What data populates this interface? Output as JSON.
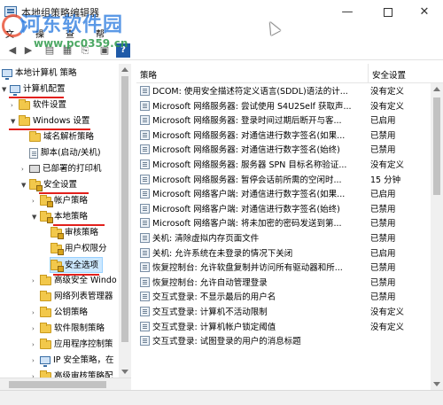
{
  "window": {
    "title": "本地组策略编辑器",
    "minimize": "—",
    "close": "✕"
  },
  "watermark": {
    "text": "河东软件园",
    "url": "www.pc0359.cn"
  },
  "menu": [
    "文",
    "操",
    "查",
    "帮"
  ],
  "toolbar": {
    "help": "?"
  },
  "tree": {
    "header": "本地计算机 策略",
    "items": [
      {
        "label": "计算机配置",
        "icon": "computer-icon"
      },
      {
        "label": "软件设置",
        "icon": "folder-icon"
      },
      {
        "label": "Windows 设置",
        "icon": "folder-icon"
      },
      {
        "label": "域名解析策略",
        "icon": "folder-icon"
      },
      {
        "label": "脚本(启动/关机)",
        "icon": "doc-icon"
      },
      {
        "label": "已部署的打印机",
        "icon": "printer-icon"
      },
      {
        "label": "安全设置",
        "icon": "folder-lock-icon"
      },
      {
        "label": "帐户策略",
        "icon": "folder-lock-icon"
      },
      {
        "label": "本地策略",
        "icon": "folder-lock-icon"
      },
      {
        "label": "审核策略",
        "icon": "folder-lock-icon"
      },
      {
        "label": "用户权限分",
        "icon": "folder-lock-icon"
      },
      {
        "label": "安全选项",
        "icon": "folder-lock-icon"
      },
      {
        "label": "高级安全 Windo",
        "icon": "folder-icon"
      },
      {
        "label": "网络列表管理器",
        "icon": "folder-icon"
      },
      {
        "label": "公钥策略",
        "icon": "folder-icon"
      },
      {
        "label": "软件限制策略",
        "icon": "folder-icon"
      },
      {
        "label": "应用程序控制策",
        "icon": "folder-icon"
      },
      {
        "label": "IP 安全策略，在",
        "icon": "folder-icon"
      },
      {
        "label": "高级审核策略配",
        "icon": "folder-icon"
      }
    ]
  },
  "list": {
    "col_policy": "策略",
    "col_setting": "安全设置",
    "rows": [
      {
        "policy": "DCOM: 使用安全描述符定义语言(SDDL)语法的计...",
        "setting": "没有定义"
      },
      {
        "policy": "Microsoft 网络服务器: 尝试使用 S4U2Self 获取声...",
        "setting": "没有定义"
      },
      {
        "policy": "Microsoft 网络服务器: 登录时间过期后断开与客...",
        "setting": "已启用"
      },
      {
        "policy": "Microsoft 网络服务器: 对通信进行数字签名(如果...",
        "setting": "已禁用"
      },
      {
        "policy": "Microsoft 网络服务器: 对通信进行数字签名(始终)",
        "setting": "已禁用"
      },
      {
        "policy": "Microsoft 网络服务器: 服务器 SPN 目标名称验证...",
        "setting": "没有定义"
      },
      {
        "policy": "Microsoft 网络服务器: 暂停会话前所需的空闲时...",
        "setting": "15 分钟"
      },
      {
        "policy": "Microsoft 网络客户端: 对通信进行数字签名(如果...",
        "setting": "已启用"
      },
      {
        "policy": "Microsoft 网络客户端: 对通信进行数字签名(始终)",
        "setting": "已禁用"
      },
      {
        "policy": "Microsoft 网络客户端: 将未加密的密码发送到第...",
        "setting": "已禁用"
      },
      {
        "policy": "关机: 清除虚拟内存页面文件",
        "setting": "已禁用"
      },
      {
        "policy": "关机: 允许系统在未登录的情况下关闭",
        "setting": "已启用"
      },
      {
        "policy": "恢复控制台: 允许软盘复制并访问所有驱动器和所...",
        "setting": "已禁用"
      },
      {
        "policy": "恢复控制台: 允许自动管理登录",
        "setting": "已禁用"
      },
      {
        "policy": "交互式登录: 不显示最后的用户名",
        "setting": "已禁用"
      },
      {
        "policy": "交互式登录: 计算机不活动限制",
        "setting": "没有定义"
      },
      {
        "policy": "交互式登录: 计算机帐户锁定阈值",
        "setting": "没有定义"
      },
      {
        "policy": "交互式登录: 试图登录的用户的消息标题",
        "setting": ""
      }
    ]
  }
}
